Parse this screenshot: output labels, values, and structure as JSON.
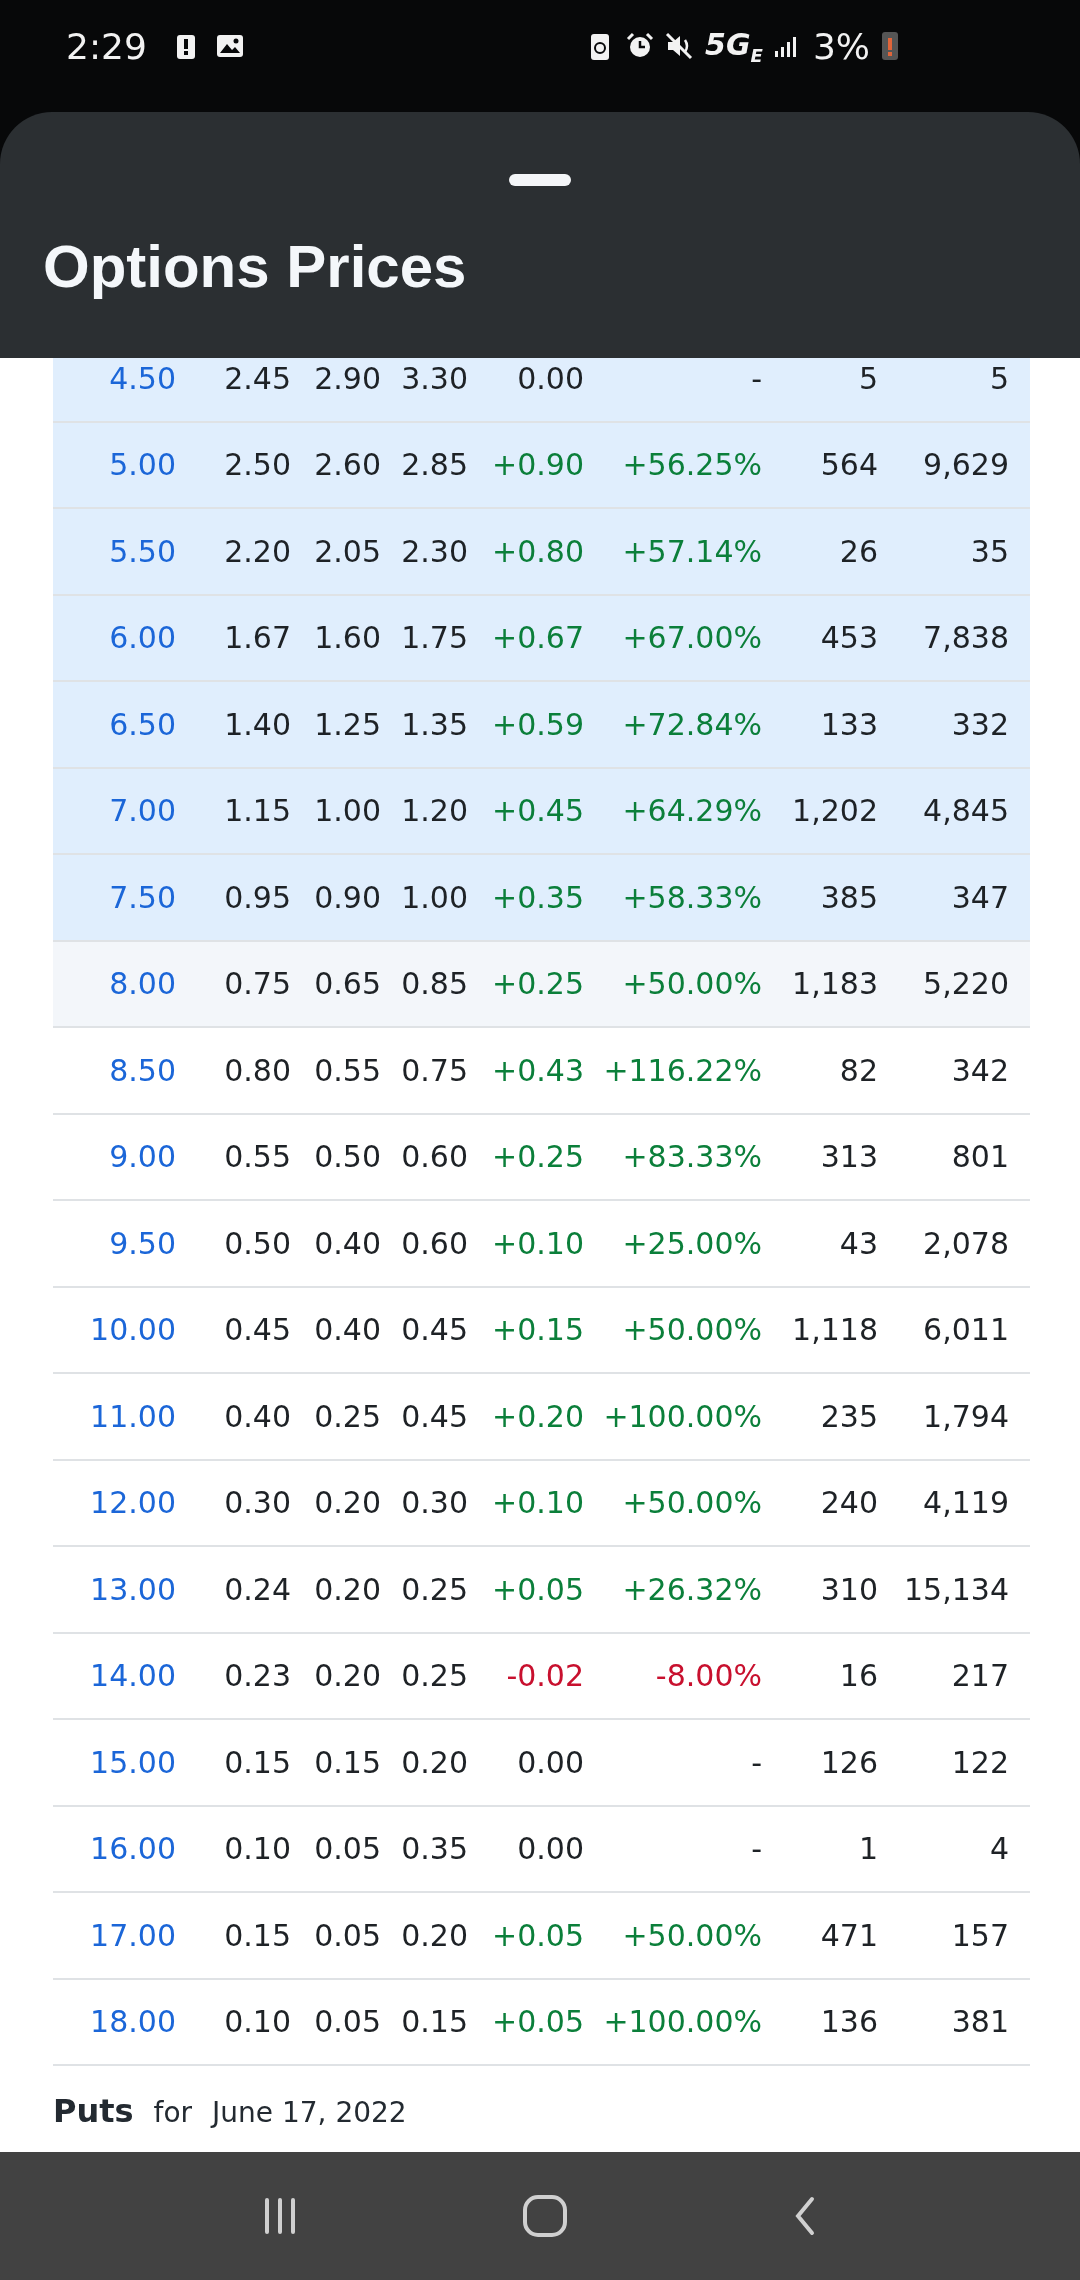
{
  "status_bar": {
    "time": "2:29",
    "network": "5G$_{E}$",
    "battery": "3%"
  },
  "sheet": {
    "title": "Options Prices"
  },
  "calls": [
    {
      "kind": "in_the_money",
      "color": "#1e2226",
      "cells": [
        "4.50",
        "2.45",
        "2.90",
        "3.30",
        "0.00",
        "-",
        "5",
        "5"
      ]
    },
    {
      "kind": "in_the_money",
      "color": "#0b7f3a",
      "cells": [
        "5.00",
        "2.50",
        "2.60",
        "2.85",
        "+0.90",
        "+56.25%",
        "564",
        "9,629"
      ]
    },
    {
      "kind": "in_the_money",
      "color": "#0b7f3a",
      "cells": [
        "5.50",
        "2.20",
        "2.05",
        "2.30",
        "+0.80",
        "+57.14%",
        "26",
        "35"
      ]
    },
    {
      "kind": "in_the_money",
      "color": "#0b7f3a",
      "cells": [
        "6.00",
        "1.67",
        "1.60",
        "1.75",
        "+0.67",
        "+67.00%",
        "453",
        "7,838"
      ]
    },
    {
      "kind": "in_the_money",
      "color": "#0b7f3a",
      "cells": [
        "6.50",
        "1.40",
        "1.25",
        "1.35",
        "+0.59",
        "+72.84%",
        "133",
        "332"
      ]
    },
    {
      "kind": "in_the_money",
      "color": "#0b7f3a",
      "cells": [
        "7.00",
        "1.15",
        "1.00",
        "1.20",
        "+0.45",
        "+64.29%",
        "1,202",
        "4,845"
      ]
    },
    {
      "kind": "in_the_money",
      "color": "#0b7f3a",
      "cells": [
        "7.50",
        "0.95",
        "0.90",
        "1.00",
        "+0.35",
        "+58.33%",
        "385",
        "347"
      ]
    },
    {
      "kind": "at_the_money",
      "color": "#0b7f3a",
      "cells": [
        "8.00",
        "0.75",
        "0.65",
        "0.85",
        "+0.25",
        "+50.00%",
        "1,183",
        "5,220"
      ]
    },
    {
      "kind": "out_of_the_money",
      "color": "#0b7f3a",
      "cells": [
        "8.50",
        "0.80",
        "0.55",
        "0.75",
        "+0.43",
        "+116.22%",
        "82",
        "342"
      ]
    },
    {
      "kind": "out_of_the_money",
      "color": "#0b7f3a",
      "cells": [
        "9.00",
        "0.55",
        "0.50",
        "0.60",
        "+0.25",
        "+83.33%",
        "313",
        "801"
      ]
    },
    {
      "kind": "out_of_the_money",
      "color": "#0b7f3a",
      "cells": [
        "9.50",
        "0.50",
        "0.40",
        "0.60",
        "+0.10",
        "+25.00%",
        "43",
        "2,078"
      ]
    },
    {
      "kind": "out_of_the_money",
      "color": "#0b7f3a",
      "cells": [
        "10.00",
        "0.45",
        "0.40",
        "0.45",
        "+0.15",
        "+50.00%",
        "1,118",
        "6,011"
      ]
    },
    {
      "kind": "out_of_the_money",
      "color": "#0b7f3a",
      "cells": [
        "11.00",
        "0.40",
        "0.25",
        "0.45",
        "+0.20",
        "+100.00%",
        "235",
        "1,794"
      ]
    },
    {
      "kind": "out_of_the_money",
      "color": "#0b7f3a",
      "cells": [
        "12.00",
        "0.30",
        "0.20",
        "0.30",
        "+0.10",
        "+50.00%",
        "240",
        "4,119"
      ]
    },
    {
      "kind": "out_of_the_money",
      "color": "#0b7f3a",
      "cells": [
        "13.00",
        "0.24",
        "0.20",
        "0.25",
        "+0.05",
        "+26.32%",
        "310",
        "15,134"
      ]
    },
    {
      "kind": "out_of_the_money",
      "color": "#c8102e",
      "cells": [
        "14.00",
        "0.23",
        "0.20",
        "0.25",
        "-0.02",
        "-8.00%",
        "16",
        "217"
      ]
    },
    {
      "kind": "out_of_the_money",
      "color": "#1e2226",
      "cells": [
        "15.00",
        "0.15",
        "0.15",
        "0.20",
        "0.00",
        "-",
        "126",
        "122"
      ]
    },
    {
      "kind": "out_of_the_money",
      "color": "#1e2226",
      "cells": [
        "16.00",
        "0.10",
        "0.05",
        "0.35",
        "0.00",
        "-",
        "1",
        "4"
      ]
    },
    {
      "kind": "out_of_the_money",
      "color": "#0b7f3a",
      "cells": [
        "17.00",
        "0.15",
        "0.05",
        "0.20",
        "+0.05",
        "+50.00%",
        "471",
        "157"
      ]
    },
    {
      "kind": "out_of_the_money",
      "color": "#0b7f3a",
      "cells": [
        "18.00",
        "0.10",
        "0.05",
        "0.15",
        "+0.05",
        "+100.00%",
        "136",
        "381"
      ]
    }
  ],
  "puts_heading": {
    "title": "Puts",
    "connector": "for",
    "date": "June 17, 2022"
  }
}
